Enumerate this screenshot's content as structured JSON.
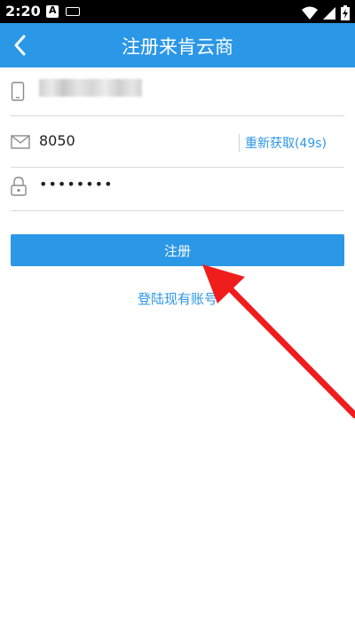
{
  "status_bar": {
    "time": "2:20",
    "icons": [
      "notification-a-icon",
      "keyboard-icon",
      "wifi-icon",
      "signal-icon",
      "battery-charging-icon"
    ]
  },
  "header": {
    "title": "注册来肯云商",
    "back_icon": "chevron-left-icon",
    "background": "#2b97e7"
  },
  "form": {
    "phone": {
      "icon": "phone-icon",
      "value_blurred": true
    },
    "code": {
      "icon": "mail-icon",
      "value": "8050",
      "resend_label": "重新获取(49s)"
    },
    "password": {
      "icon": "lock-icon",
      "value": "••••••••"
    }
  },
  "register_button": {
    "label": "注册"
  },
  "login_link": {
    "label": "登陆现有账号"
  },
  "colors": {
    "accent": "#2b97e7",
    "annotation_arrow": "#f01d1d"
  }
}
